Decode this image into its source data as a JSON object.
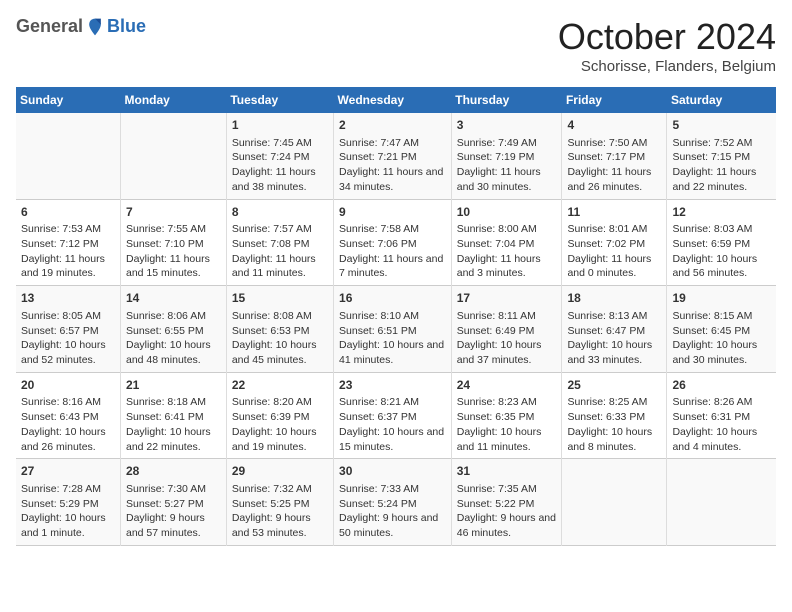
{
  "logo": {
    "general": "General",
    "blue": "Blue"
  },
  "header": {
    "month": "October 2024",
    "location": "Schorisse, Flanders, Belgium"
  },
  "weekdays": [
    "Sunday",
    "Monday",
    "Tuesday",
    "Wednesday",
    "Thursday",
    "Friday",
    "Saturday"
  ],
  "weeks": [
    [
      {
        "day": "",
        "info": ""
      },
      {
        "day": "",
        "info": ""
      },
      {
        "day": "1",
        "info": "Sunrise: 7:45 AM\nSunset: 7:24 PM\nDaylight: 11 hours and 38 minutes."
      },
      {
        "day": "2",
        "info": "Sunrise: 7:47 AM\nSunset: 7:21 PM\nDaylight: 11 hours and 34 minutes."
      },
      {
        "day": "3",
        "info": "Sunrise: 7:49 AM\nSunset: 7:19 PM\nDaylight: 11 hours and 30 minutes."
      },
      {
        "day": "4",
        "info": "Sunrise: 7:50 AM\nSunset: 7:17 PM\nDaylight: 11 hours and 26 minutes."
      },
      {
        "day": "5",
        "info": "Sunrise: 7:52 AM\nSunset: 7:15 PM\nDaylight: 11 hours and 22 minutes."
      }
    ],
    [
      {
        "day": "6",
        "info": "Sunrise: 7:53 AM\nSunset: 7:12 PM\nDaylight: 11 hours and 19 minutes."
      },
      {
        "day": "7",
        "info": "Sunrise: 7:55 AM\nSunset: 7:10 PM\nDaylight: 11 hours and 15 minutes."
      },
      {
        "day": "8",
        "info": "Sunrise: 7:57 AM\nSunset: 7:08 PM\nDaylight: 11 hours and 11 minutes."
      },
      {
        "day": "9",
        "info": "Sunrise: 7:58 AM\nSunset: 7:06 PM\nDaylight: 11 hours and 7 minutes."
      },
      {
        "day": "10",
        "info": "Sunrise: 8:00 AM\nSunset: 7:04 PM\nDaylight: 11 hours and 3 minutes."
      },
      {
        "day": "11",
        "info": "Sunrise: 8:01 AM\nSunset: 7:02 PM\nDaylight: 11 hours and 0 minutes."
      },
      {
        "day": "12",
        "info": "Sunrise: 8:03 AM\nSunset: 6:59 PM\nDaylight: 10 hours and 56 minutes."
      }
    ],
    [
      {
        "day": "13",
        "info": "Sunrise: 8:05 AM\nSunset: 6:57 PM\nDaylight: 10 hours and 52 minutes."
      },
      {
        "day": "14",
        "info": "Sunrise: 8:06 AM\nSunset: 6:55 PM\nDaylight: 10 hours and 48 minutes."
      },
      {
        "day": "15",
        "info": "Sunrise: 8:08 AM\nSunset: 6:53 PM\nDaylight: 10 hours and 45 minutes."
      },
      {
        "day": "16",
        "info": "Sunrise: 8:10 AM\nSunset: 6:51 PM\nDaylight: 10 hours and 41 minutes."
      },
      {
        "day": "17",
        "info": "Sunrise: 8:11 AM\nSunset: 6:49 PM\nDaylight: 10 hours and 37 minutes."
      },
      {
        "day": "18",
        "info": "Sunrise: 8:13 AM\nSunset: 6:47 PM\nDaylight: 10 hours and 33 minutes."
      },
      {
        "day": "19",
        "info": "Sunrise: 8:15 AM\nSunset: 6:45 PM\nDaylight: 10 hours and 30 minutes."
      }
    ],
    [
      {
        "day": "20",
        "info": "Sunrise: 8:16 AM\nSunset: 6:43 PM\nDaylight: 10 hours and 26 minutes."
      },
      {
        "day": "21",
        "info": "Sunrise: 8:18 AM\nSunset: 6:41 PM\nDaylight: 10 hours and 22 minutes."
      },
      {
        "day": "22",
        "info": "Sunrise: 8:20 AM\nSunset: 6:39 PM\nDaylight: 10 hours and 19 minutes."
      },
      {
        "day": "23",
        "info": "Sunrise: 8:21 AM\nSunset: 6:37 PM\nDaylight: 10 hours and 15 minutes."
      },
      {
        "day": "24",
        "info": "Sunrise: 8:23 AM\nSunset: 6:35 PM\nDaylight: 10 hours and 11 minutes."
      },
      {
        "day": "25",
        "info": "Sunrise: 8:25 AM\nSunset: 6:33 PM\nDaylight: 10 hours and 8 minutes."
      },
      {
        "day": "26",
        "info": "Sunrise: 8:26 AM\nSunset: 6:31 PM\nDaylight: 10 hours and 4 minutes."
      }
    ],
    [
      {
        "day": "27",
        "info": "Sunrise: 7:28 AM\nSunset: 5:29 PM\nDaylight: 10 hours and 1 minute."
      },
      {
        "day": "28",
        "info": "Sunrise: 7:30 AM\nSunset: 5:27 PM\nDaylight: 9 hours and 57 minutes."
      },
      {
        "day": "29",
        "info": "Sunrise: 7:32 AM\nSunset: 5:25 PM\nDaylight: 9 hours and 53 minutes."
      },
      {
        "day": "30",
        "info": "Sunrise: 7:33 AM\nSunset: 5:24 PM\nDaylight: 9 hours and 50 minutes."
      },
      {
        "day": "31",
        "info": "Sunrise: 7:35 AM\nSunset: 5:22 PM\nDaylight: 9 hours and 46 minutes."
      },
      {
        "day": "",
        "info": ""
      },
      {
        "day": "",
        "info": ""
      }
    ]
  ]
}
